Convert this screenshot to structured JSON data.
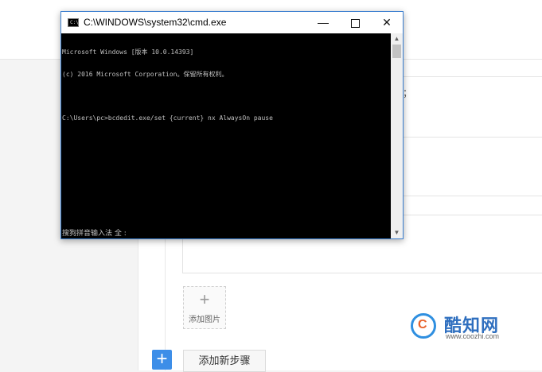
{
  "cmd_window": {
    "title": "C:\\WINDOWS\\system32\\cmd.exe",
    "app_icon_text": "C:\\",
    "controls": {
      "minimize": "—",
      "close": "✕"
    },
    "console_lines": [
      "Microsoft Windows [版本 10.0.14393]",
      "(c) 2016 Microsoft Corporation。保留所有权利。",
      "",
      "C:\\Users\\pc>bcdedit.exe/set {current} nx AlwaysOn pause"
    ],
    "ime_status": "搜狗拼音输入法 全 :",
    "scroll": {
      "up_arrow": "▲",
      "down_arrow": "▼"
    }
  },
  "page": {
    "side_mark": "；",
    "add_image": {
      "icon": "plus-icon",
      "plus": "+",
      "label": "添加图片"
    },
    "add_step": {
      "plus": "+",
      "label": "添加新步骤"
    }
  },
  "watermark": {
    "logo_letter": "C",
    "name": "酷知网",
    "url": "www.coozhi.com"
  },
  "colors": {
    "accent": "#3d8ee8",
    "console_bg": "#000000",
    "console_text": "#c0c0c0"
  }
}
